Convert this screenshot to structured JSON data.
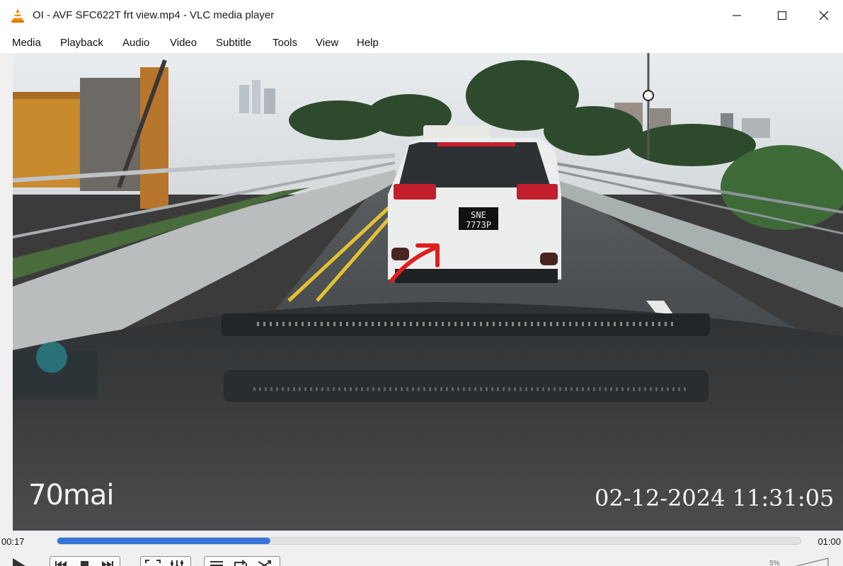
{
  "window": {
    "title": "OI - AVF SFC622T frt view.mp4 - VLC media player",
    "app_icon": "vlc-cone-icon",
    "controls": {
      "minimize": "–",
      "maximize": "☐",
      "close": "✕"
    }
  },
  "menu": {
    "items": [
      "Media",
      "Playback",
      "Audio",
      "Video",
      "Subtitle",
      "Tools",
      "View",
      "Help"
    ]
  },
  "video": {
    "brand_watermark": "70mai",
    "timestamp": "02-12-2024 11:31:05",
    "plate_line1": "SNE",
    "plate_line2": "7773P"
  },
  "seek": {
    "elapsed": "00:17",
    "total": "01:00",
    "progress_fraction": 0.287,
    "fill_color": "#3874d8"
  },
  "controls": {
    "buttons": [
      "play-icon",
      "previous-icon",
      "stop-icon",
      "next-icon",
      "fullscreen-icon",
      "extended-settings-icon",
      "playlist-icon",
      "loop-icon",
      "shuffle-icon"
    ],
    "volume": "5%",
    "volume_fraction": 0.05
  },
  "colors": {
    "vlc_orange": "#f28c00",
    "annotation_arrow": "#e01e1e"
  }
}
